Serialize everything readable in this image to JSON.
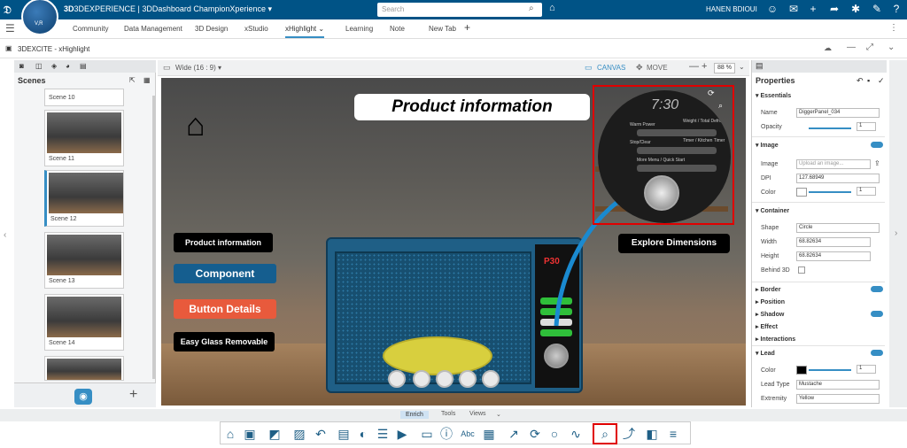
{
  "topbar": {
    "brand_prefix": "3D",
    "brand": "3DEXPERIENCE | 3DDashboard ChampionXperience ▾",
    "compass_label": "V,R",
    "search_placeholder": "Search",
    "user": "HANEN BDIOUI"
  },
  "tabs": [
    "Community",
    "Data Management",
    "3D Design",
    "xStudio",
    "xHighlight",
    "Learning",
    "Note",
    "New Tab"
  ],
  "app_title": "3DEXCITE - xHighlight",
  "scenes": {
    "title": "Scenes",
    "items": [
      "Scene 10",
      "Scene 11",
      "Scene 12",
      "Scene 13",
      "Scene 14"
    ]
  },
  "canvas_toolbar": {
    "aspect": "Wide (16 : 9) ▾",
    "canvas": "CANVAS",
    "move": "MOVE",
    "zoom": "88 %"
  },
  "canvas": {
    "title": "Product information",
    "buttons": [
      "Product information",
      "Component",
      "Button Details",
      "Easy Glass Removable"
    ],
    "explore": "Explore Dimensions",
    "zoom_clock": "7:30",
    "zoom_labels": [
      "Warm Power",
      "Weight / Total Defrost",
      "Stop/Clear",
      "Timer / Kitchen Timer",
      "More Menu / Quick Start"
    ]
  },
  "properties": {
    "title": "Properties",
    "essentials": "Essentials",
    "name_label": "Name",
    "name_value": "DiggerPanel_034",
    "opacity_label": "Opacity",
    "opacity_value": "1",
    "image_section": "Image",
    "image_label": "Image",
    "image_placeholder": "Upload an image...",
    "dpi_label": "DPI",
    "dpi_value": "127.68949",
    "color_label": "Color",
    "color_value": "1",
    "container": "Container",
    "shape_label": "Shape",
    "shape_value": "Circle",
    "width_label": "Width",
    "width_value": "68.82634",
    "height_label": "Height",
    "height_value": "68.82634",
    "behind_label": "Behind 3D",
    "collapsed": [
      "Border",
      "Position",
      "Shadow",
      "Effect",
      "Interactions"
    ],
    "lead": "Lead",
    "lead_color_label": "Color",
    "lead_color_value": "1",
    "lead_type_label": "Lead Type",
    "lead_type_value": "Mustache",
    "extremity_label": "Extremity",
    "extremity_value": "Yellow"
  },
  "bottom_tabs": [
    "Enrich",
    "Tools",
    "Views"
  ],
  "colors": {
    "topbar": "#005386",
    "accent": "#368ec4",
    "highlight": "#e00000",
    "component_btn": "#155e8f",
    "details_btn": "#e85a3c"
  }
}
